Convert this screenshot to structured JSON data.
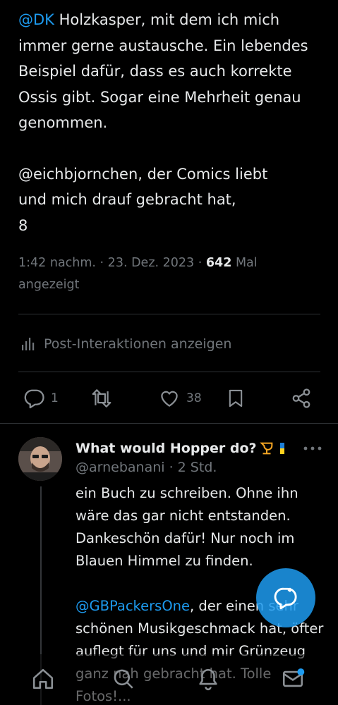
{
  "tweet": {
    "p1_mention": "@DK",
    "p1_text": " Holzkasper, mit dem ich mich immer gerne austausche. Ein lebendes Beispiel dafür, dass es auch korrekte Ossis gibt. Sogar eine Mehrheit genau genommen.",
    "p2_line1": "@eichbjornchen, der Comics liebt",
    "p2_line2": "und mich drauf gebracht hat,",
    "p2_line3": "8"
  },
  "meta": {
    "time_date": "1:42 nachm. · 23. Dez. 2023 · ",
    "views": "642",
    "views_label": " Mal",
    "views_label2": "angezeigt"
  },
  "interactions_label": "Post-Interaktionen anzeigen",
  "actions": {
    "reply_count": "1",
    "like_count": "38"
  },
  "reply": {
    "name": "What would Hopper do?",
    "handle_time": "@arnebanani · 2 Std.",
    "para1": "ein Buch zu schreiben. Ohne ihn wäre das gar nicht entstanden. Dankeschön dafür! Nur noch im Blauen Himmel zu finden.",
    "para2_mention": "@GBPackersOne",
    "para2_text": ", der einen sehr schönen Musikgeschmack hat, öfter auflegt für uns und mir Grünzeug ganz nah gebracht hat. Tolle Fotos!..."
  },
  "colors": {
    "accent": "#1d9bf0",
    "text": "#e7e9ea",
    "muted": "#71767b",
    "background": "#000000"
  },
  "icons": [
    "reply-icon",
    "repost-icon",
    "like-icon",
    "bookmark-icon",
    "share-icon",
    "analytics-icon",
    "more-icon",
    "compose-icon",
    "home-icon",
    "search-icon",
    "notifications-icon",
    "messages-icon"
  ]
}
